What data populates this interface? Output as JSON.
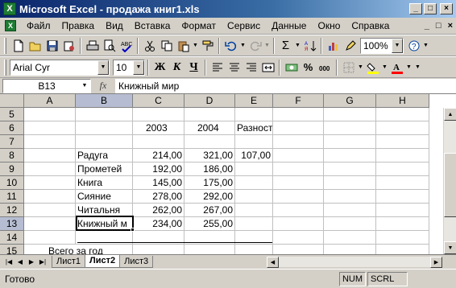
{
  "window": {
    "title": "Microsoft Excel - продажа книг1.xls",
    "app_icon": "X",
    "minimize": "_",
    "maximize": "□",
    "close": "×"
  },
  "menu": {
    "items": [
      "Файл",
      "Правка",
      "Вид",
      "Вставка",
      "Формат",
      "Сервис",
      "Данные",
      "Окно",
      "Справка"
    ],
    "doc_controls": [
      "_",
      "□",
      "×"
    ]
  },
  "toolbar": {
    "zoom": "100%",
    "sigma": "Σ"
  },
  "format_toolbar": {
    "font_name": "Arial Cyr",
    "font_size": "10",
    "bold": "Ж",
    "italic": "К",
    "underline": "Ч",
    "percent": "%",
    "font_color": "#ff0000",
    "fill_color": "#ffff00"
  },
  "formula_bar": {
    "name_box": "B13",
    "fx": "fx",
    "content": "Книжный мир"
  },
  "columns": [
    "A",
    "B",
    "C",
    "D",
    "E",
    "F",
    "G",
    "H"
  ],
  "selected_column": "B",
  "rows": [
    {
      "num": "5",
      "cells": [
        "",
        "",
        "",
        "",
        "",
        "",
        "",
        ""
      ]
    },
    {
      "num": "6",
      "cells": [
        "",
        "",
        "2003",
        "2004",
        "Разность",
        "",
        "",
        ""
      ]
    },
    {
      "num": "7",
      "cells": [
        "",
        "",
        "",
        "",
        "",
        "",
        "",
        ""
      ]
    },
    {
      "num": "8",
      "cells": [
        "",
        "Радуга",
        "214,00",
        "321,00",
        "107,00",
        "",
        "",
        ""
      ]
    },
    {
      "num": "9",
      "cells": [
        "",
        "Прометей",
        "192,00",
        "186,00",
        "",
        "",
        "",
        ""
      ]
    },
    {
      "num": "10",
      "cells": [
        "",
        "Книга",
        "145,00",
        "175,00",
        "",
        "",
        "",
        ""
      ]
    },
    {
      "num": "11",
      "cells": [
        "",
        "Сияние",
        "278,00",
        "292,00",
        "",
        "",
        "",
        ""
      ]
    },
    {
      "num": "12",
      "cells": [
        "",
        "Читальня",
        "262,00",
        "267,00",
        "",
        "",
        "",
        ""
      ]
    },
    {
      "num": "13",
      "cells": [
        "",
        "Книжный м",
        "234,00",
        "255,00",
        "",
        "",
        "",
        ""
      ]
    },
    {
      "num": "14",
      "cells": [
        "",
        "",
        "",
        "",
        "",
        "",
        "",
        ""
      ]
    },
    {
      "num": "15",
      "cells": [
        "Всего за год",
        "",
        "",
        "",
        "",
        "",
        "",
        ""
      ]
    }
  ],
  "selected_row": "13",
  "sheets": {
    "tabs": [
      "Лист1",
      "Лист2",
      "Лист3"
    ],
    "active": "Лист2"
  },
  "status": {
    "text": "Готово",
    "num": "NUM",
    "scrl": "SCRL"
  }
}
